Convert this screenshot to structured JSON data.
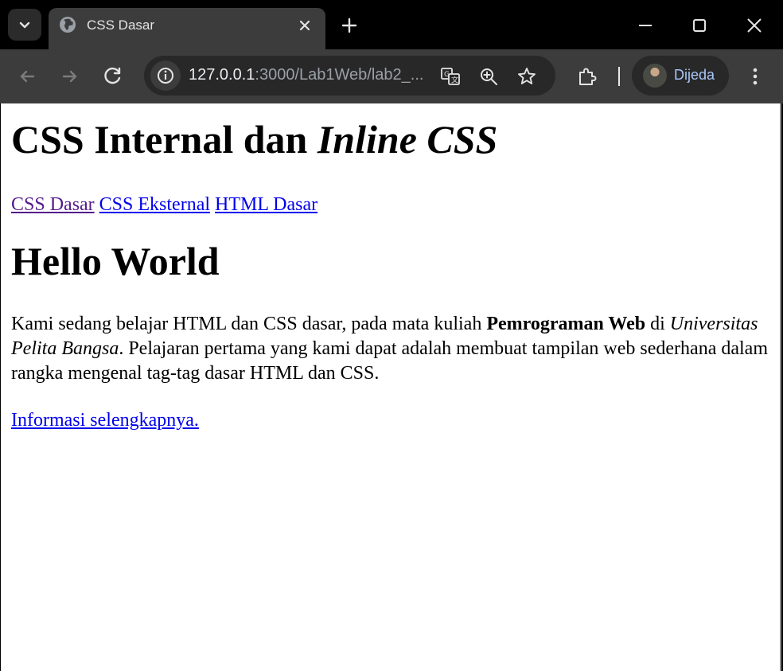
{
  "browser": {
    "tab": {
      "title": "CSS Dasar"
    },
    "url": {
      "host": "127.0.0.1",
      "rest": ":3000/Lab1Web/lab2_..."
    },
    "profile": {
      "name": "Dijeda"
    },
    "colors": {
      "titlebar": "#000000",
      "toolbar": "#3c3c3c",
      "omnibox": "#282828",
      "profile_text": "#a8c7fa"
    },
    "icons": [
      "tab-list-icon",
      "globe-icon",
      "close-icon",
      "plus-icon",
      "minimize-icon",
      "maximize-icon",
      "window-close-icon",
      "back-arrow-icon",
      "forward-arrow-icon",
      "reload-icon",
      "site-info-icon",
      "translate-icon",
      "zoom-icon",
      "star-icon",
      "extensions-icon",
      "more-vert-icon"
    ]
  },
  "page": {
    "heading": {
      "normal": "CSS Internal dan ",
      "italic": "Inline CSS"
    },
    "nav": [
      {
        "label": "CSS Dasar",
        "visited": true
      },
      {
        "label": "CSS Eksternal",
        "visited": false
      },
      {
        "label": "HTML Dasar",
        "visited": false
      }
    ],
    "hello": "Hello World",
    "intro": {
      "part1": "Kami sedang belajar HTML dan CSS dasar, pada mata kuliah ",
      "bold": "Pemrograman Web",
      "part2": " di ",
      "italic": "Universitas Pelita Bangsa",
      "part3": ". Pelajaran pertama yang kami dapat adalah membuat tampilan web sederhana dalam rangka mengenal tag-tag dasar HTML dan CSS."
    },
    "more_link": "Informasi selengkapnya.",
    "colors": {
      "link": "#0000ee",
      "visited_link": "#551a8b"
    }
  }
}
